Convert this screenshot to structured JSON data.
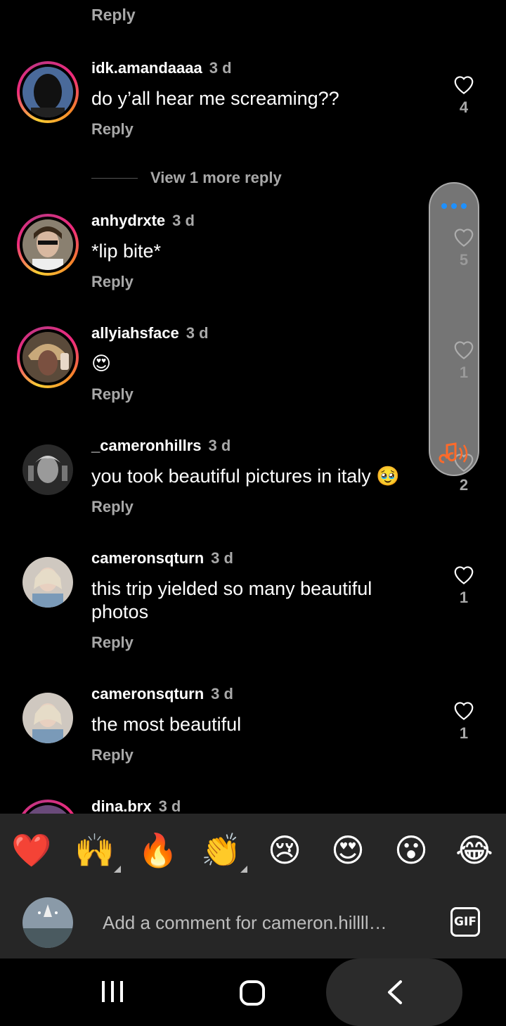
{
  "top_reply": "Reply",
  "comments": [
    {
      "username": "idk.amandaaaa",
      "time": "3 d",
      "text": "do y’all hear me screaming??",
      "reply": "Reply",
      "likes": "4"
    },
    {
      "username": "anhydrxte",
      "time": "3 d",
      "text": "*lip bite*",
      "reply": "Reply",
      "likes": "5"
    },
    {
      "username": "allyiahsface",
      "time": "3 d",
      "text": "😍",
      "reply": "Reply",
      "likes": "1"
    },
    {
      "username": "_cameronhillrs",
      "time": "3 d",
      "text": "you took beautiful pictures in italy 🥹",
      "reply": "Reply",
      "likes": "2"
    },
    {
      "username": "cameronsqturn",
      "time": "3 d",
      "text": "this trip yielded so many beautiful photos",
      "reply": "Reply",
      "likes": "1"
    },
    {
      "username": "cameronsqturn",
      "time": "3 d",
      "text": "the most beautiful",
      "reply": "Reply",
      "likes": "1"
    },
    {
      "username": "dina.brx",
      "time": "3 d"
    }
  ],
  "view_more": "View 1 more reply",
  "reactions": [
    "❤️",
    "🙌",
    "🔥",
    "👏",
    "😢",
    "😍",
    "😮",
    "😂"
  ],
  "comment_input": {
    "placeholder": "Add a comment for cameron.hillll…"
  },
  "gif_label": "GIF",
  "colors": {
    "background": "#000000",
    "secondary_text": "#a8a8a8",
    "bar": "#262626",
    "accent": "#1e90ff"
  }
}
